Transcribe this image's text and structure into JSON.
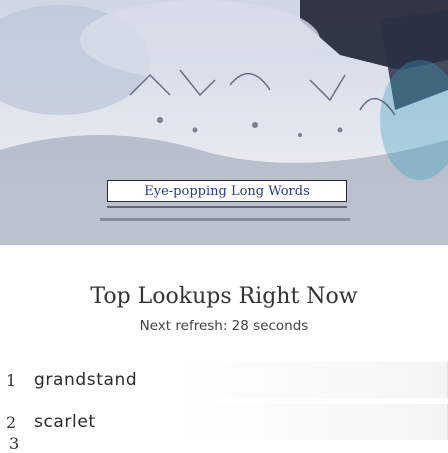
{
  "hero": {
    "banner_text": "Eye-popping Long Words"
  },
  "lookups": {
    "title": "Top Lookups Right Now",
    "subtitle": "Next refresh: 28 seconds",
    "items": [
      {
        "rank": "1",
        "word": "grandstand"
      },
      {
        "rank": "2",
        "word": "scarlet"
      },
      {
        "rank": "3",
        "word": ""
      }
    ]
  }
}
